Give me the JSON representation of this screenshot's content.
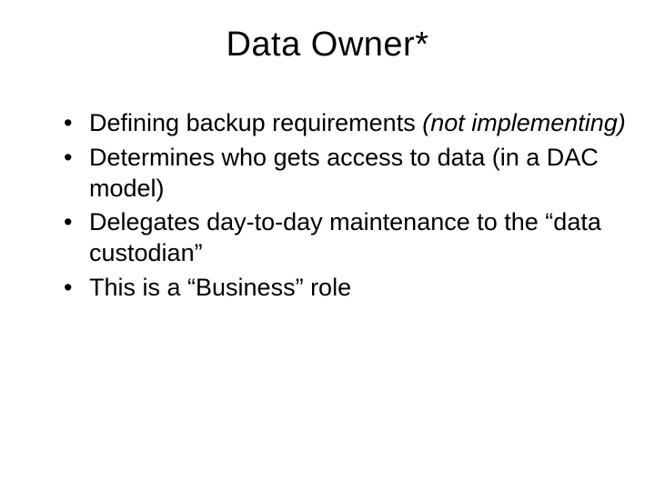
{
  "slide": {
    "title": "Data Owner*",
    "bullets": [
      {
        "prefix": "Defining backup requirements ",
        "italic": "(not implementing)"
      },
      {
        "text": "Determines who gets access to data (in a DAC model)"
      },
      {
        "text": "Delegates day-to-day maintenance to the “data custodian”"
      },
      {
        "text": "This is a “Business” role"
      }
    ]
  }
}
